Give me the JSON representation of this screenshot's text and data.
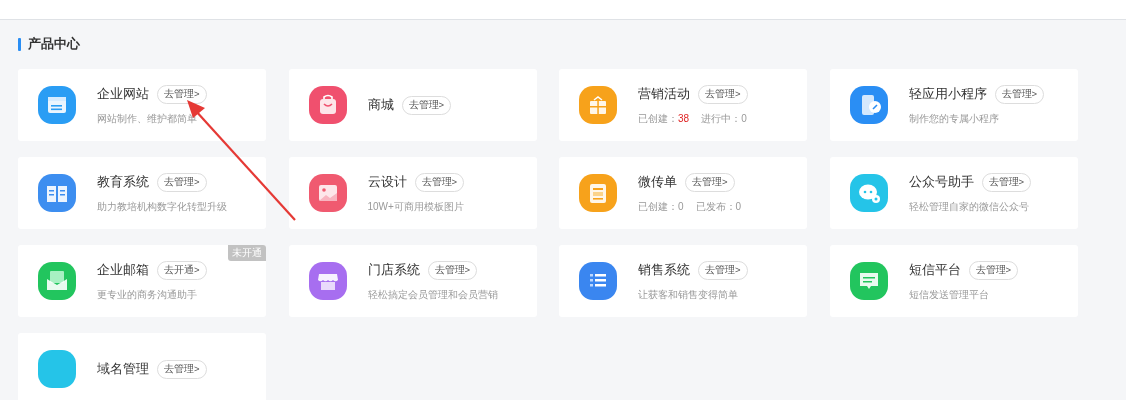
{
  "section": {
    "title": "产品中心"
  },
  "products": [
    {
      "name": "企业网站",
      "action": "去管理>",
      "kind": "desc",
      "desc": "网站制作、维护都简单"
    },
    {
      "name": "商城",
      "action": "去管理>",
      "kind": "none"
    },
    {
      "name": "营销活动",
      "action": "去管理>",
      "kind": "stats",
      "stats": [
        {
          "label": "已创建：",
          "value": "38",
          "highlight": true
        },
        {
          "label": "进行中：",
          "value": "0",
          "highlight": false
        }
      ]
    },
    {
      "name": "轻应用小程序",
      "action": "去管理>",
      "kind": "desc",
      "desc": "制作您的专属小程序"
    },
    {
      "name": "教育系统",
      "action": "去管理>",
      "kind": "desc",
      "desc": "助力教培机构数字化转型升级"
    },
    {
      "name": "云设计",
      "action": "去管理>",
      "kind": "desc",
      "desc": "10W+可商用模板图片"
    },
    {
      "name": "微传单",
      "action": "去管理>",
      "kind": "stats",
      "stats": [
        {
          "label": "已创建：",
          "value": "0",
          "highlight": false
        },
        {
          "label": "已发布：",
          "value": "0",
          "highlight": false
        }
      ]
    },
    {
      "name": "公众号助手",
      "action": "去管理>",
      "kind": "desc",
      "desc": "轻松管理自家的微信公众号"
    },
    {
      "name": "企业邮箱",
      "action": "去开通>",
      "kind": "desc",
      "desc": "更专业的商务沟通助手",
      "badge": "未开通"
    },
    {
      "name": "门店系统",
      "action": "去管理>",
      "kind": "desc",
      "desc": "轻松搞定会员管理和会员营销"
    },
    {
      "name": "销售系统",
      "action": "去管理>",
      "kind": "desc",
      "desc": "让获客和销售变得简单"
    },
    {
      "name": "短信平台",
      "action": "去管理>",
      "kind": "desc",
      "desc": "短信发送管理平台"
    },
    {
      "name": "域名管理",
      "action": "去管理>",
      "kind": "none"
    }
  ]
}
